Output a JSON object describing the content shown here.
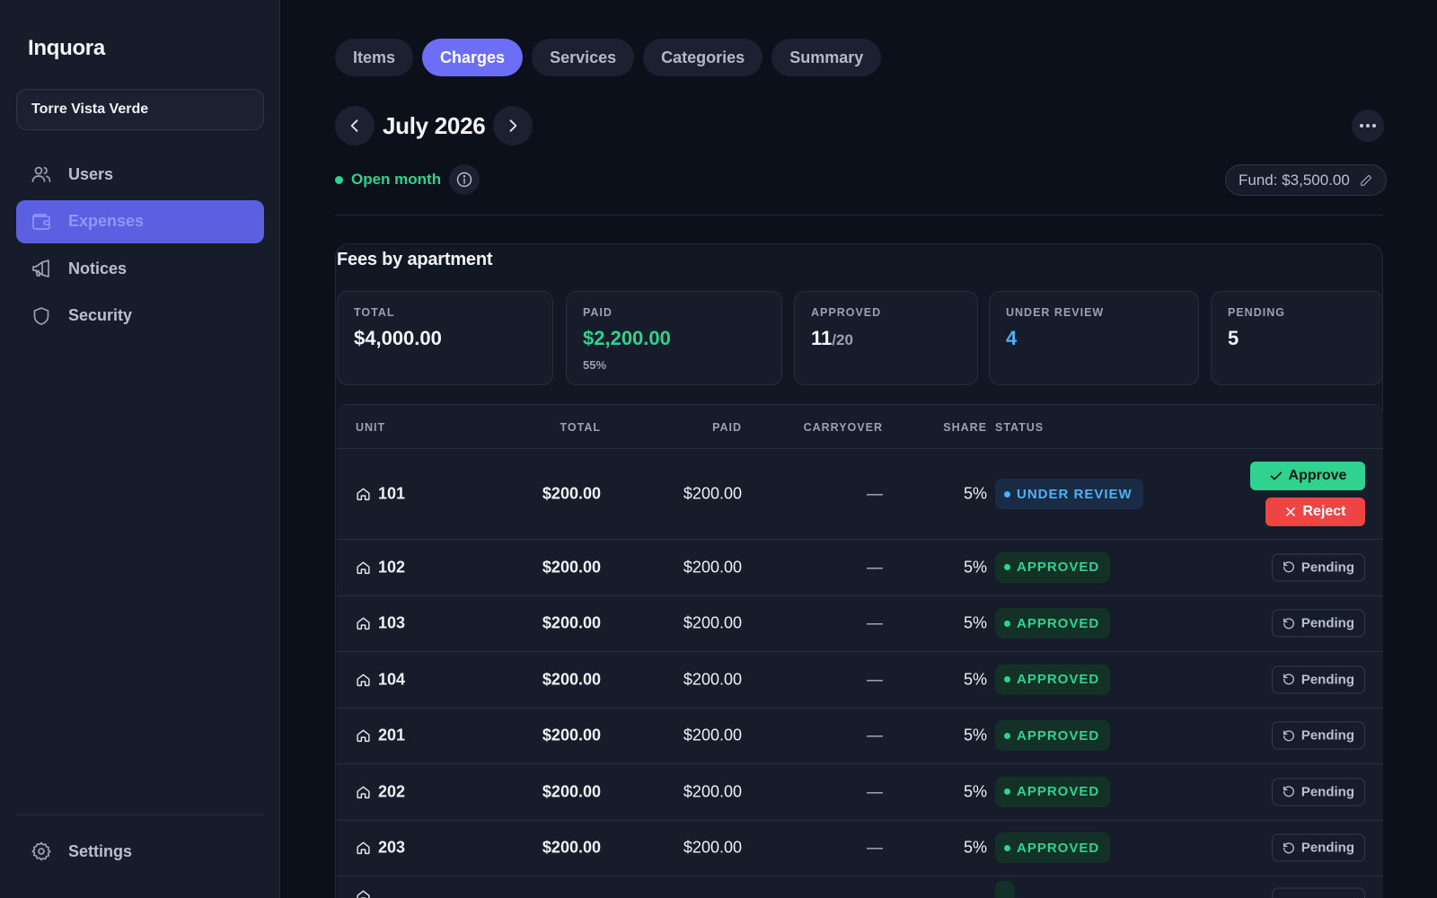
{
  "app": {
    "brand": "Inquora"
  },
  "sidebar": {
    "building": "Torre Vista Verde",
    "items": [
      {
        "label": "Users",
        "icon": "users-icon",
        "active": false
      },
      {
        "label": "Expenses",
        "icon": "wallet-icon",
        "active": true
      },
      {
        "label": "Notices",
        "icon": "megaphone-icon",
        "active": false
      },
      {
        "label": "Security",
        "icon": "shield-icon",
        "active": false
      }
    ],
    "settings": {
      "label": "Settings",
      "icon": "gear-icon"
    }
  },
  "tabs": [
    {
      "label": "Items",
      "active": false
    },
    {
      "label": "Charges",
      "active": true
    },
    {
      "label": "Services",
      "active": false
    },
    {
      "label": "Categories",
      "active": false
    },
    {
      "label": "Summary",
      "active": false
    }
  ],
  "period": {
    "month": "July 2026",
    "status": "Open month",
    "fund": "Fund: $3,500.00"
  },
  "panel": {
    "title": "Fees by apartment",
    "stats": {
      "total": {
        "label": "TOTAL",
        "value": "$4,000.00"
      },
      "paid": {
        "label": "PAID",
        "value": "$2,200.00",
        "sub": "55%"
      },
      "approved": {
        "label": "APPROVED",
        "value": "11",
        "of": "/20"
      },
      "under_review": {
        "label": "UNDER REVIEW",
        "value": "4"
      },
      "pending": {
        "label": "PENDING",
        "value": "5"
      }
    },
    "columns": {
      "unit": "UNIT",
      "total": "TOTAL",
      "paid": "PAID",
      "carryover": "CARRYOVER",
      "share": "SHARE",
      "status": "STATUS"
    },
    "actions": {
      "approve": "Approve",
      "reject": "Reject",
      "pending": "Pending"
    },
    "rows": [
      {
        "unit": "101",
        "total": "$200.00",
        "paid": "$200.00",
        "carryover": "—",
        "share": "5%",
        "status": "UNDER REVIEW"
      },
      {
        "unit": "102",
        "total": "$200.00",
        "paid": "$200.00",
        "carryover": "—",
        "share": "5%",
        "status": "APPROVED"
      },
      {
        "unit": "103",
        "total": "$200.00",
        "paid": "$200.00",
        "carryover": "—",
        "share": "5%",
        "status": "APPROVED"
      },
      {
        "unit": "104",
        "total": "$200.00",
        "paid": "$200.00",
        "carryover": "—",
        "share": "5%",
        "status": "APPROVED"
      },
      {
        "unit": "201",
        "total": "$200.00",
        "paid": "$200.00",
        "carryover": "—",
        "share": "5%",
        "status": "APPROVED"
      },
      {
        "unit": "202",
        "total": "$200.00",
        "paid": "$200.00",
        "carryover": "—",
        "share": "5%",
        "status": "APPROVED"
      },
      {
        "unit": "203",
        "total": "$200.00",
        "paid": "$200.00",
        "carryover": "—",
        "share": "5%",
        "status": "APPROVED"
      }
    ]
  },
  "colors": {
    "accent": "#6c6ff5",
    "sidebar_active": "#5b5fe0",
    "success": "#2fd38f",
    "info": "#4fb0f5",
    "danger": "#ef4444",
    "background": "#0c101a"
  }
}
